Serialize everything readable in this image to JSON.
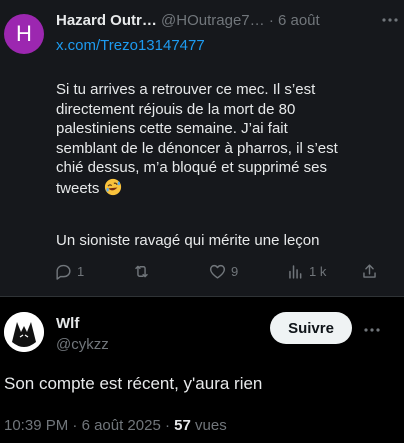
{
  "tweet1": {
    "avatar_letter": "H",
    "avatar_color": "#9c27b0",
    "name": "Hazard Outr…",
    "handle": "@HOutrage7…",
    "separator": "·",
    "date": "6 août",
    "link": "x.com/Trezo13147477",
    "paragraph1": "Si tu arrives a retrouver ce mec. Il s’est\ndirectement réjouis de la mort de 80\npalestiniens cette semaine. J’ai fait\nsemblant de le dénoncer à pharros, il s’est\nchié dessus, m’a bloqué et supprimé ses\ntweets",
    "emoji_icon": "rolling-on-floor-laughing-emoji",
    "paragraph2": "Un sioniste ravagé qui mérite une leçon",
    "actions": {
      "replies": "1",
      "reposts": "",
      "likes": "9",
      "views": "1 k"
    }
  },
  "tweet2": {
    "name": "Wlf",
    "handle": "@cykzz",
    "follow_label": "Suivre",
    "text": "Son compte est récent, y'aura rien",
    "time": "10:39 PM",
    "date": "6 août 2025",
    "separator": "·",
    "views_count": "57",
    "views_label": "vues"
  },
  "colors": {
    "background": "#000000",
    "quoted_background": "#16181c",
    "link": "#1d9bf0",
    "secondary_text": "#71767b",
    "primary_text": "#e7e9ea",
    "follow_button": "#eff3f4"
  }
}
